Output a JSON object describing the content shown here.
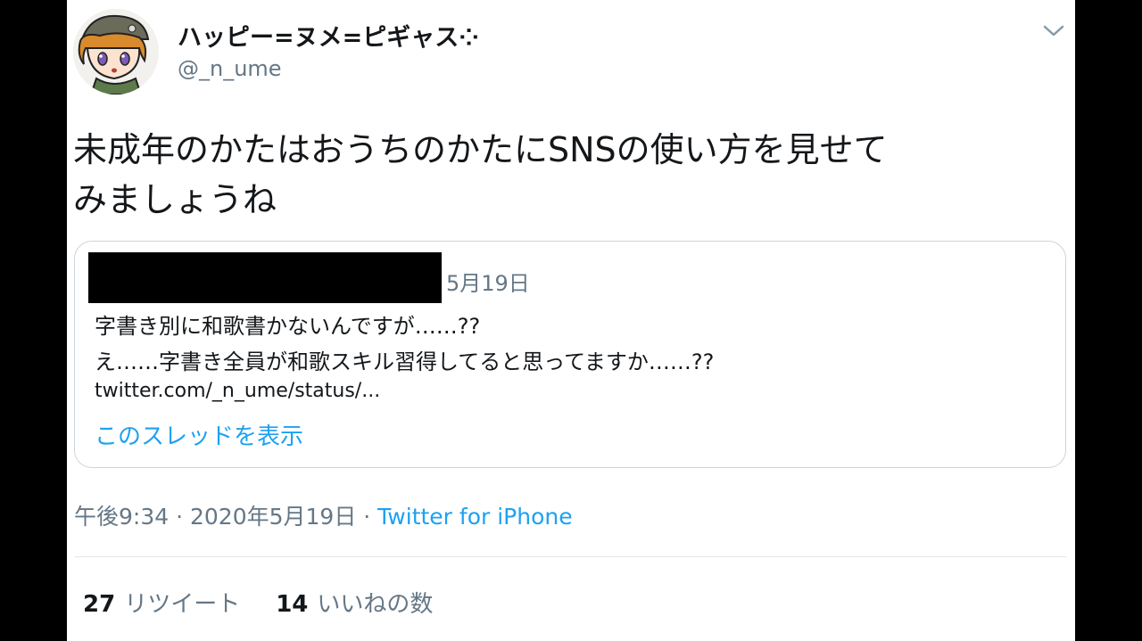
{
  "author": {
    "display_name": "ハッピー=ヌメ=ピギャス",
    "badge_glyph": "⁘",
    "handle": "@_n_ume"
  },
  "tweet": {
    "text_lines": [
      "未成年のかたはおうちのかたにSNSの使い方を見せて",
      "みましょうね"
    ]
  },
  "quoted": {
    "date": "5月19日",
    "lines": [
      "字書き別に和歌書かないんですが……??",
      "え……字書き全員が和歌スキル習得してると思ってますか……??"
    ],
    "link": "twitter.com/_n_ume/status/...",
    "thread_label": "このスレッドを表示"
  },
  "meta": {
    "time": "午後9:34",
    "separator": " · ",
    "date": "2020年5月19日",
    "source": "Twitter for iPhone"
  },
  "stats": {
    "retweets_count": "27",
    "retweets_label": "リツイート",
    "likes_count": "14",
    "likes_label": "いいねの数"
  },
  "colors": {
    "accent": "#1da1f2",
    "text": "#14171a",
    "secondary": "#657786",
    "border": "#ccd6dd"
  },
  "icons": {
    "caret": "chevron-down-icon",
    "avatar": "avatar-image"
  }
}
